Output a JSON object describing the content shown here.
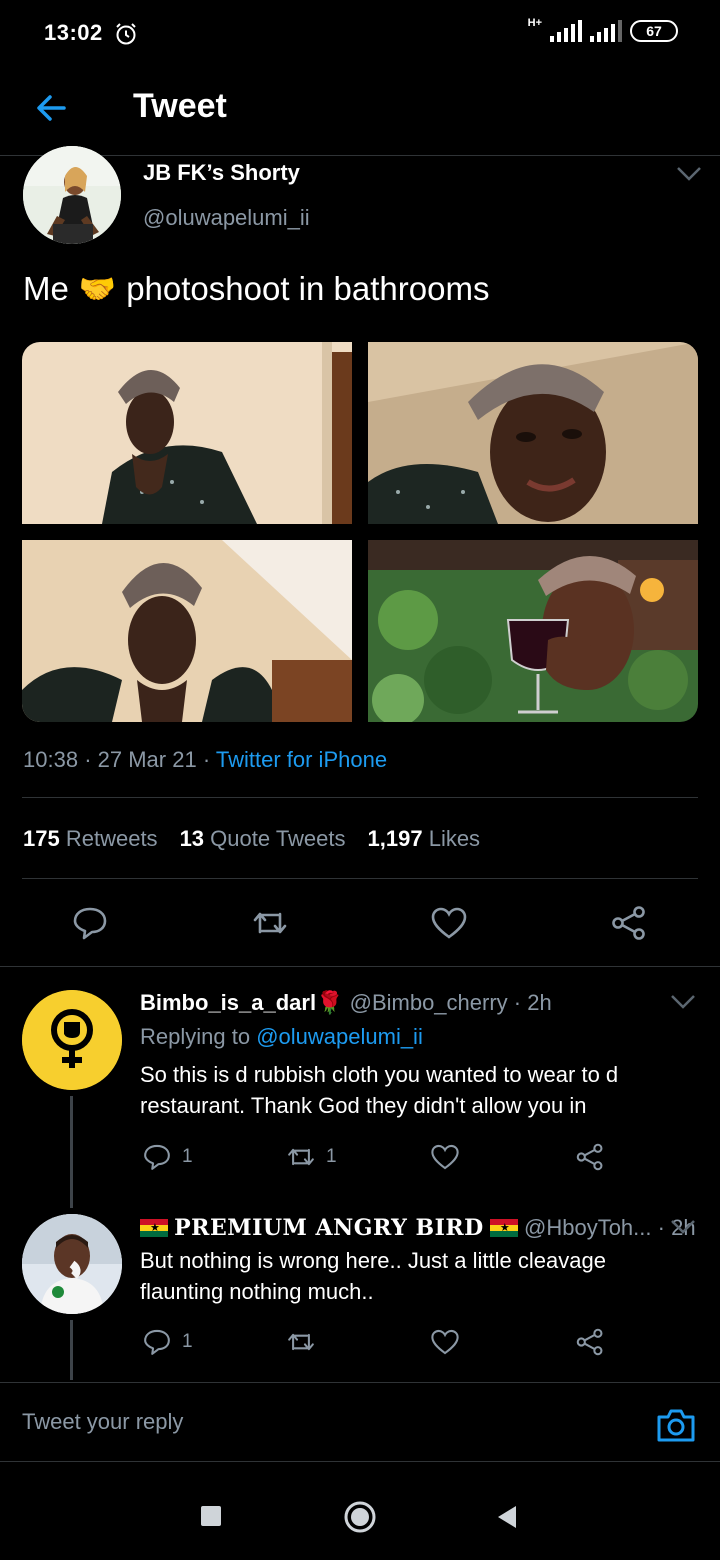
{
  "status_bar": {
    "time": "13:02",
    "network": "H+",
    "battery": "67"
  },
  "header": {
    "title": "Tweet",
    "back_icon": "arrow-left-icon"
  },
  "tweet": {
    "author_name": "JB FK’s Shorty",
    "author_handle": "@oluwapelumi_ii",
    "text_before": "Me",
    "emoji": "🤝",
    "text_after": "photoshoot in bathrooms",
    "time": "10:38",
    "date": "27 Mar 21",
    "source": "Twitter for iPhone",
    "stats": {
      "retweets_count": "175",
      "retweets_label": "Retweets",
      "quotes_count": "13",
      "quotes_label": "Quote Tweets",
      "likes_count": "1,197",
      "likes_label": "Likes"
    },
    "actions": [
      "reply-icon",
      "retweet-icon",
      "like-icon",
      "share-icon"
    ]
  },
  "replies": [
    {
      "name": "Bimbo_is_a_darl",
      "name_emoji": "🌹",
      "handle": "@Bimbo_cherry",
      "time": "2h",
      "replying_label": "Replying to",
      "replying_to": "@oluwapelumi_ii",
      "text": "So this is d rubbish cloth you wanted to wear to d restaurant. Thank God they didn't allow you in",
      "reply_count": "1",
      "retweet_count": "1"
    },
    {
      "name": "PREMIUM ANGRY BIRD",
      "handle": "@HboyToh...",
      "time": "2h",
      "text": "But nothing is wrong here.. Just a little cleavage flaunting nothing much..",
      "reply_count": "1",
      "retweet_count": ""
    }
  ],
  "composer": {
    "placeholder": "Tweet your reply",
    "camera_icon": "camera-icon"
  },
  "colors": {
    "background": "#000000",
    "accent": "#1d9bf0",
    "secondary_text": "#8b98a5",
    "divider": "#2f3336",
    "avatar_yellow": "#f7cf2e"
  }
}
